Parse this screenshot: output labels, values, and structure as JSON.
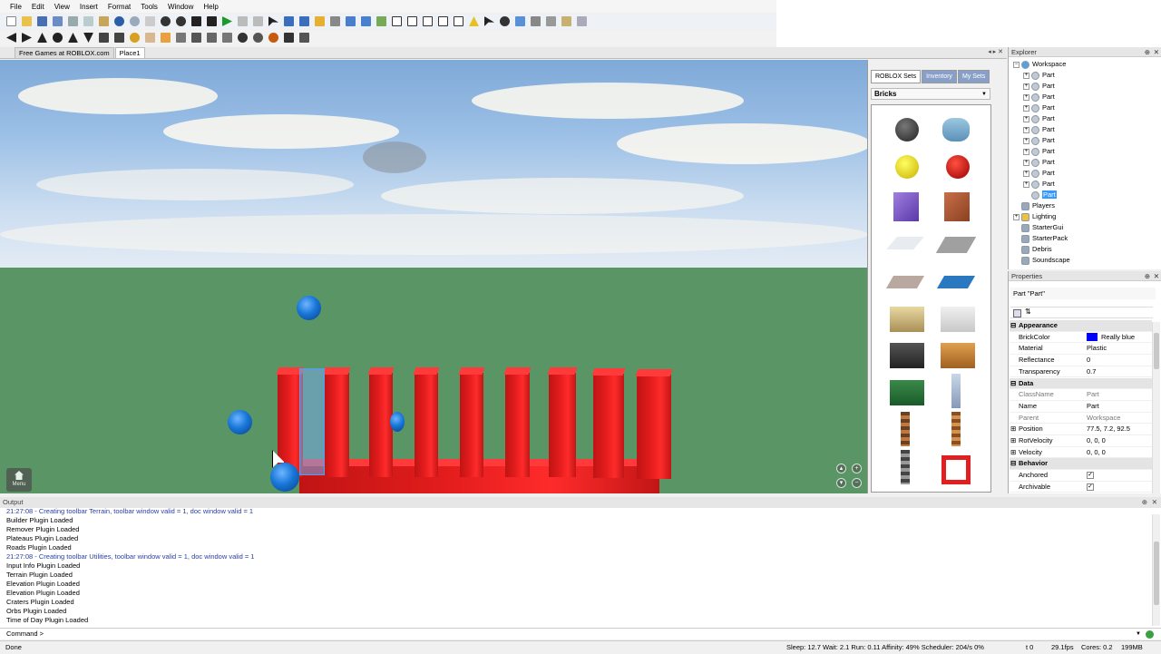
{
  "menu": [
    "File",
    "Edit",
    "View",
    "Insert",
    "Format",
    "Tools",
    "Window",
    "Help"
  ],
  "tabs": [
    {
      "label": "Free Games at ROBLOX.com",
      "active": false
    },
    {
      "label": "Place1",
      "active": true
    }
  ],
  "viewport": {
    "menu_label": "Menu"
  },
  "toolbox": {
    "tabs": [
      "ROBLOX Sets",
      "Inventory",
      "My Sets"
    ],
    "category": "Bricks"
  },
  "explorer": {
    "title": "Explorer",
    "workspace": "Workspace",
    "part": "Part",
    "services": [
      "Players",
      "Lighting",
      "StarterGui",
      "StarterPack",
      "Debris",
      "Soundscape"
    ]
  },
  "properties": {
    "title": "Properties",
    "object": "Part \"Part\"",
    "rows": [
      {
        "name": "Appearance",
        "value": "",
        "cat": true
      },
      {
        "name": "BrickColor",
        "value": "Really blue",
        "swatch": "#0000ff"
      },
      {
        "name": "Material",
        "value": "Plastic"
      },
      {
        "name": "Reflectance",
        "value": "0"
      },
      {
        "name": "Transparency",
        "value": "0.7"
      },
      {
        "name": "Data",
        "value": "",
        "cat": true
      },
      {
        "name": "ClassName",
        "value": "Part",
        "gray": true
      },
      {
        "name": "Name",
        "value": "Part"
      },
      {
        "name": "Parent",
        "value": "Workspace",
        "gray": true
      },
      {
        "name": "Position",
        "value": "77.5, 7.2, 92.5",
        "exp": true
      },
      {
        "name": "RotVelocity",
        "value": "0, 0, 0",
        "exp": true
      },
      {
        "name": "Velocity",
        "value": "0, 0, 0",
        "exp": true
      },
      {
        "name": "Behavior",
        "value": "",
        "cat": true
      },
      {
        "name": "Anchored",
        "value": "",
        "check": true
      },
      {
        "name": "Archivable",
        "value": "",
        "check": true
      }
    ]
  },
  "output": {
    "title": "Output",
    "lines": [
      {
        "t": "21:27:08 - Creating toolbar Terrain, toolbar window valid = 1, doc window valid = 1",
        "blue": true
      },
      {
        "t": "Builder Plugin Loaded"
      },
      {
        "t": "Remover Plugin Loaded"
      },
      {
        "t": "Plateaus Plugin Loaded"
      },
      {
        "t": "Roads Plugin Loaded"
      },
      {
        "t": "21:27:08 - Creating toolbar Utilities, toolbar window valid = 1, doc window valid = 1",
        "blue": true
      },
      {
        "t": "Input Info Plugin Loaded"
      },
      {
        "t": "Terrain Plugin Loaded"
      },
      {
        "t": "Elevation Plugin Loaded"
      },
      {
        "t": "Elevation Plugin Loaded"
      },
      {
        "t": "Craters Plugin Loaded"
      },
      {
        "t": "Orbs Plugin Loaded"
      },
      {
        "t": "Time of Day Plugin Loaded"
      }
    ]
  },
  "command": "Command >",
  "status": {
    "left": "Done",
    "stats": "Sleep: 12.7 Wait: 2.1 Run: 0.11 Affinity: 49% Scheduler: 204/s 0%",
    "t": "t 0",
    "fps": "29.1fps",
    "cores": "Cores: 0.2",
    "mem": "199MB"
  },
  "colors": {
    "accent": "#3399ff",
    "brick_red": "#e21c1c",
    "ball_blue": "#1877d8",
    "ground": "#5a9566"
  },
  "icons": [
    "new-icon",
    "open-icon",
    "save-icon",
    "cut-icon",
    "copy-icon",
    "paste-icon",
    "undo-icon",
    "redo-icon",
    "play-icon",
    "select-icon",
    "move-icon",
    "rotate-icon",
    "scale-icon",
    "lock-icon",
    "anchor-icon",
    "group-icon",
    "ungroup-icon"
  ]
}
